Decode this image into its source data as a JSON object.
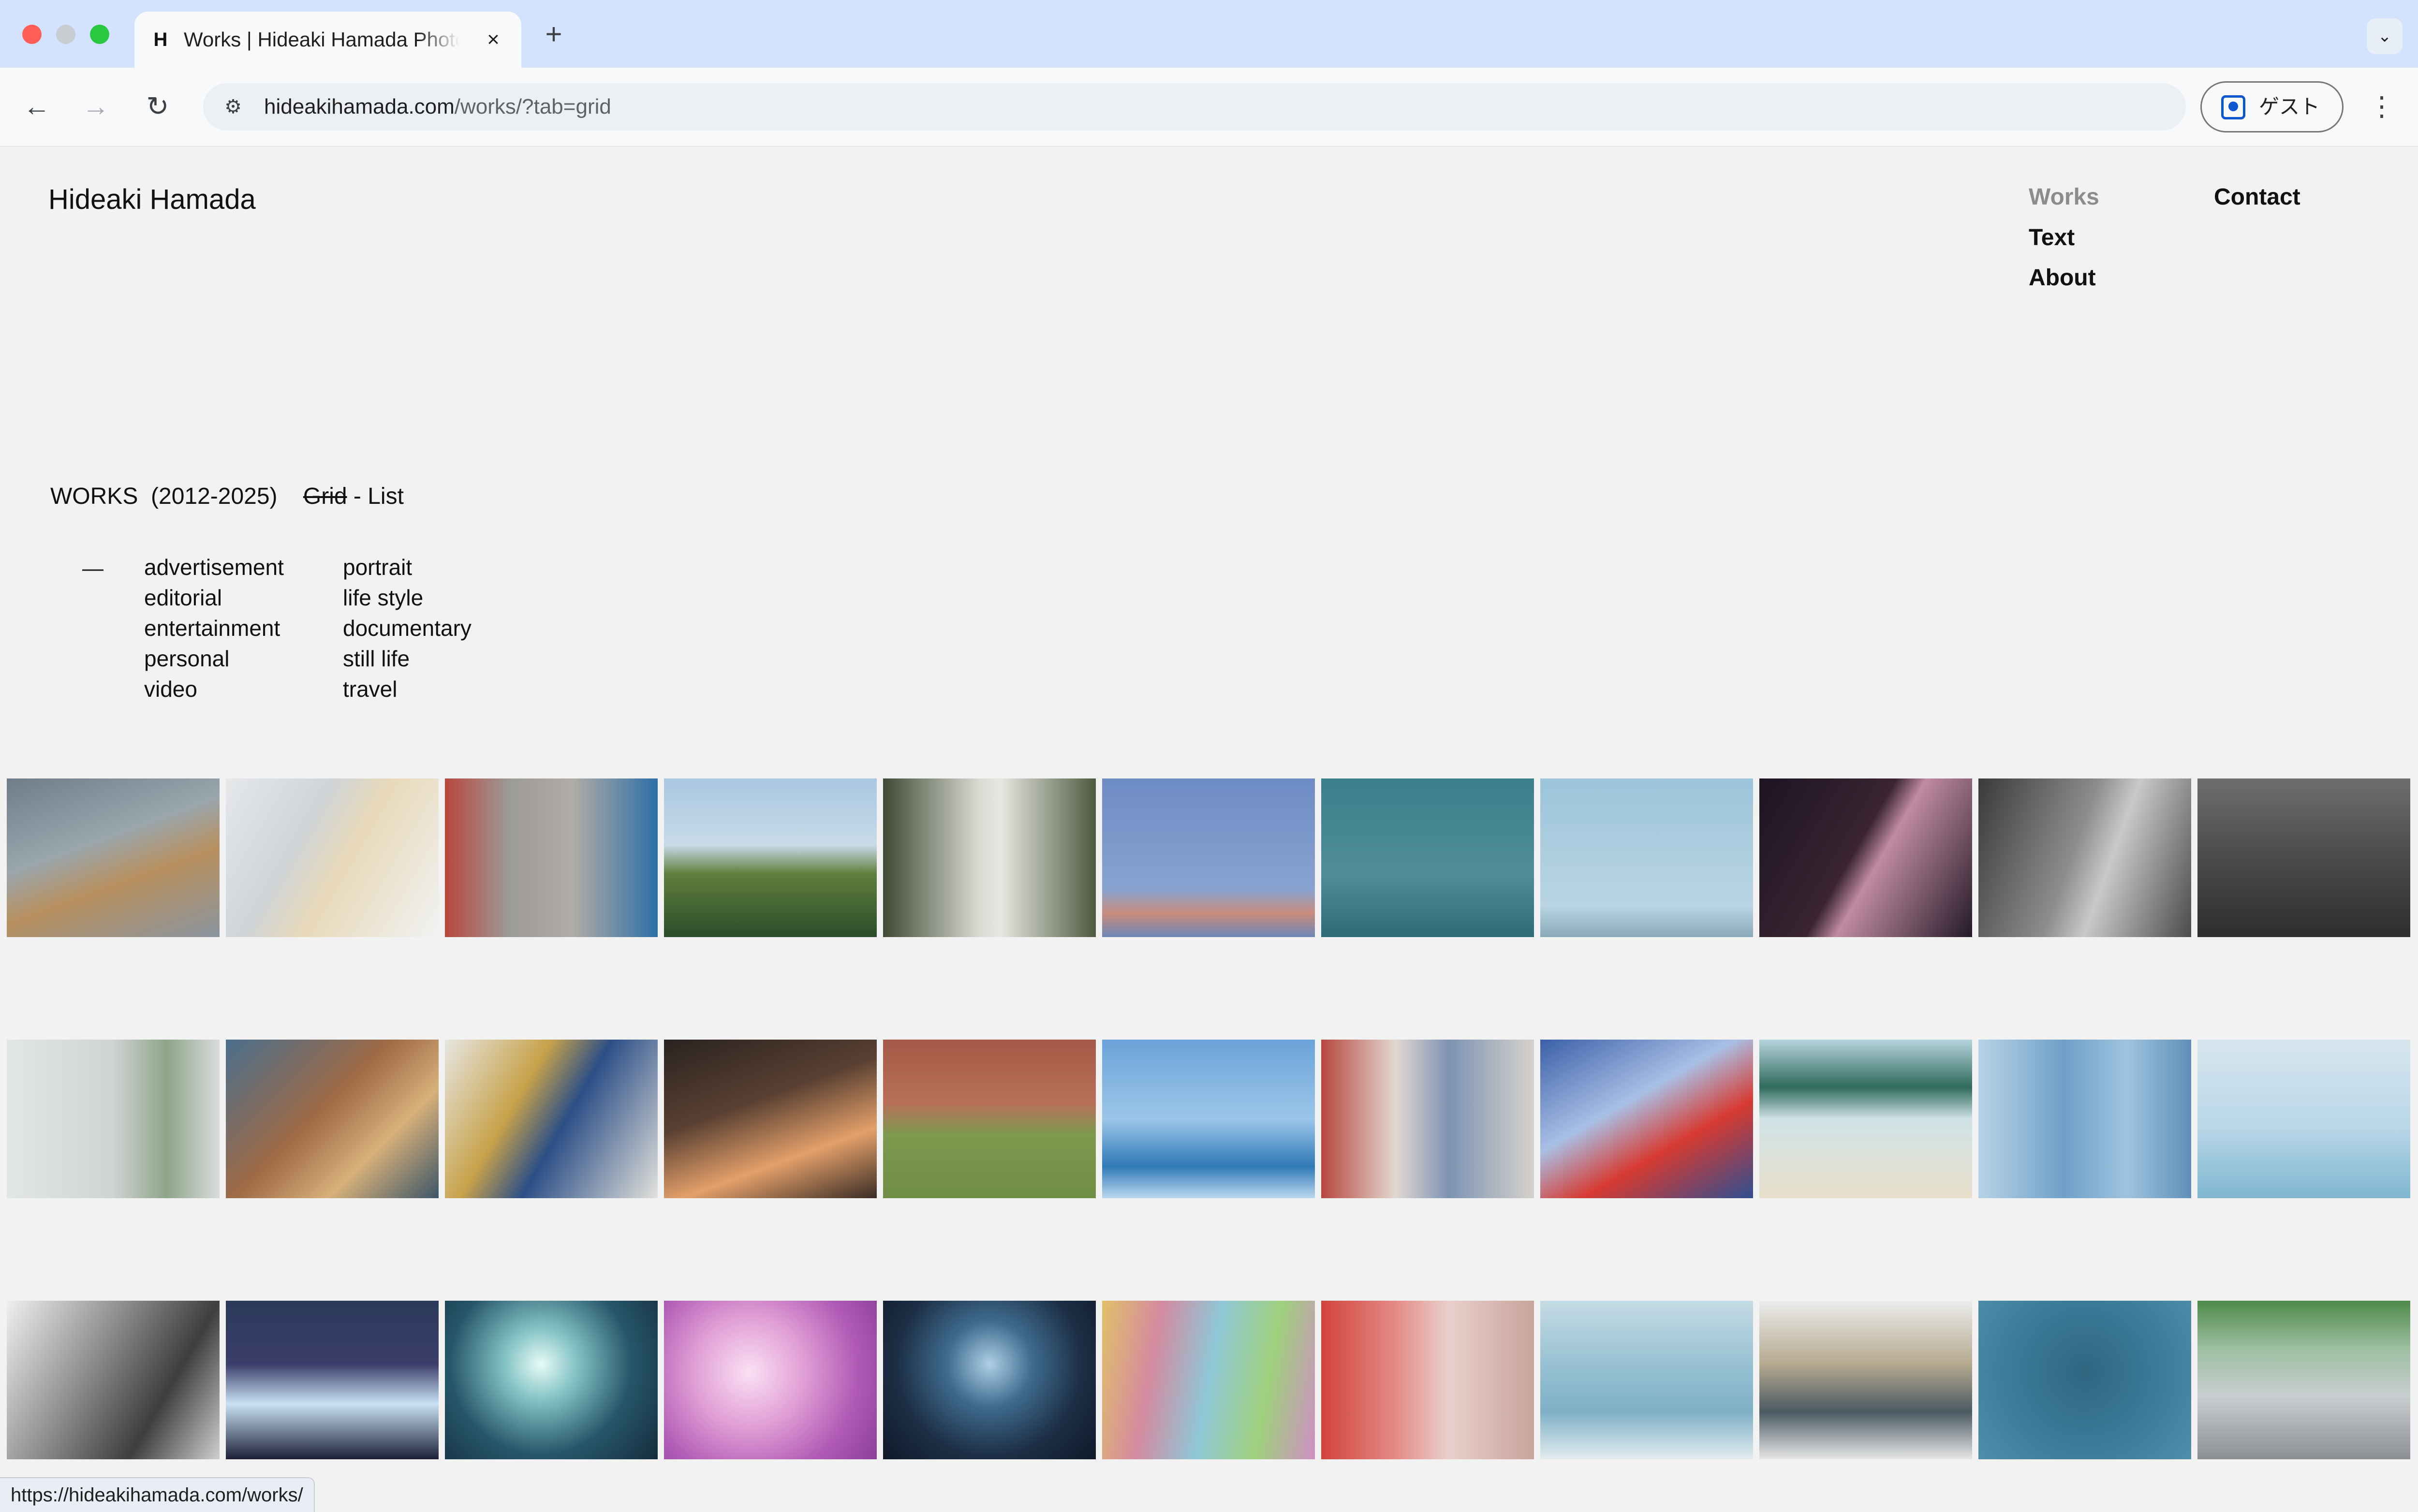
{
  "browser": {
    "tab": {
      "favicon": "H",
      "title": "Works | Hideaki Hamada Photography",
      "close_icon": "×"
    },
    "new_tab_icon": "+",
    "tab_search_icon": "⌄",
    "nav": {
      "back_icon": "←",
      "forward_icon": "→",
      "reload_icon": "↻"
    },
    "site_info_icon": "⚙",
    "url": {
      "host": "hideakihamada.com",
      "path": "/works/?tab=grid"
    },
    "profile": {
      "label": "ゲスト"
    },
    "menu_icon": "⋮",
    "status_url": "https://hideakihamada.com/works/"
  },
  "site": {
    "title": "Hideaki Hamada",
    "nav": {
      "works": "Works",
      "text": "Text",
      "about": "About",
      "contact": "Contact"
    },
    "works_heading": {
      "label": "WORKS",
      "years": "(2012-2025)",
      "grid": "Grid",
      "separator": "-",
      "list": "List"
    },
    "category_dash": "—",
    "categories_col1": [
      "advertisement",
      "editorial",
      "entertainment",
      "personal",
      "video"
    ],
    "categories_col2": [
      "portrait",
      "life style",
      "documentary",
      "still life",
      "travel"
    ]
  }
}
